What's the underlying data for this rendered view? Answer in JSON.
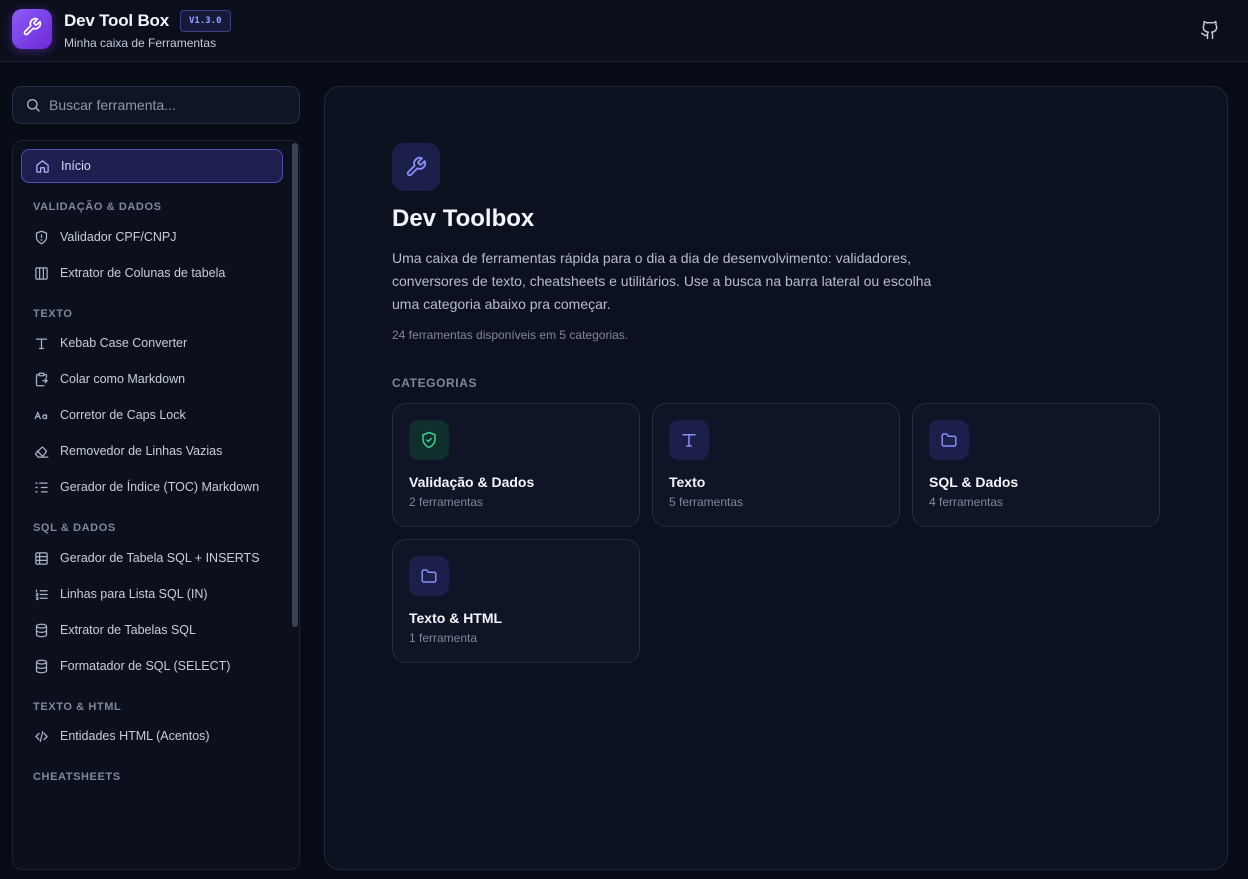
{
  "header": {
    "title": "Dev Tool Box",
    "version": "V1.3.0",
    "subtitle": "Minha caixa de Ferramentas",
    "github_icon": "github-icon"
  },
  "search": {
    "placeholder": "Buscar ferramenta..."
  },
  "sidebar": {
    "home": {
      "label": "Início",
      "icon": "home-icon"
    },
    "sections": [
      {
        "label": "VALIDAÇÃO & DADOS",
        "items": [
          {
            "label": "Validador CPF/CNPJ",
            "icon": "shield-icon"
          },
          {
            "label": "Extrator de Colunas de tabela",
            "icon": "columns-icon"
          }
        ]
      },
      {
        "label": "TEXTO",
        "items": [
          {
            "label": "Kebab Case Converter",
            "icon": "type-icon"
          },
          {
            "label": "Colar como Markdown",
            "icon": "clipboard-icon"
          },
          {
            "label": "Corretor de Caps Lock",
            "icon": "case-icon"
          },
          {
            "label": "Removedor de Linhas Vazias",
            "icon": "eraser-icon"
          },
          {
            "label": "Gerador de Índice (TOC) Markdown",
            "icon": "list-indent-icon"
          }
        ]
      },
      {
        "label": "SQL & DADOS",
        "items": [
          {
            "label": "Gerador de Tabela SQL + INSERTS",
            "icon": "table-icon"
          },
          {
            "label": "Linhas para Lista SQL (IN)",
            "icon": "list-ordered-icon"
          },
          {
            "label": "Extrator de Tabelas SQL",
            "icon": "database-icon"
          },
          {
            "label": "Formatador de SQL (SELECT)",
            "icon": "database-icon"
          }
        ]
      },
      {
        "label": "TEXTO & HTML",
        "items": [
          {
            "label": "Entidades HTML (Acentos)",
            "icon": "code-icon"
          }
        ]
      },
      {
        "label": "CHEATSHEETS",
        "items": []
      }
    ]
  },
  "main": {
    "icon": "wrench-icon",
    "title": "Dev Toolbox",
    "description": "Uma caixa de ferramentas rápida para o dia a dia de desenvolvimento: validadores, conversores de texto, cheatsheets e utilitários. Use a busca na barra lateral ou escolha uma categoria abaixo pra começar.",
    "count": "24 ferramentas disponíveis em 5 categorias.",
    "categories_label": "CATEGORIAS",
    "categories": [
      {
        "name": "Validação & Dados",
        "count": "2 ferramentas",
        "icon": "shield-check-icon",
        "color": "#34d399"
      },
      {
        "name": "Texto",
        "count": "5 ferramentas",
        "icon": "type-icon",
        "color": "#8b8cf8"
      },
      {
        "name": "SQL & Dados",
        "count": "4 ferramentas",
        "icon": "folder-icon",
        "color": "#8b8cf8"
      },
      {
        "name": "Texto & HTML",
        "count": "1 ferramenta",
        "icon": "folder-icon",
        "color": "#8b8cf8"
      }
    ]
  },
  "colors": {
    "accent": "#6366f1",
    "logo_gradient": "#8b5cf6",
    "background": "#080c16"
  }
}
